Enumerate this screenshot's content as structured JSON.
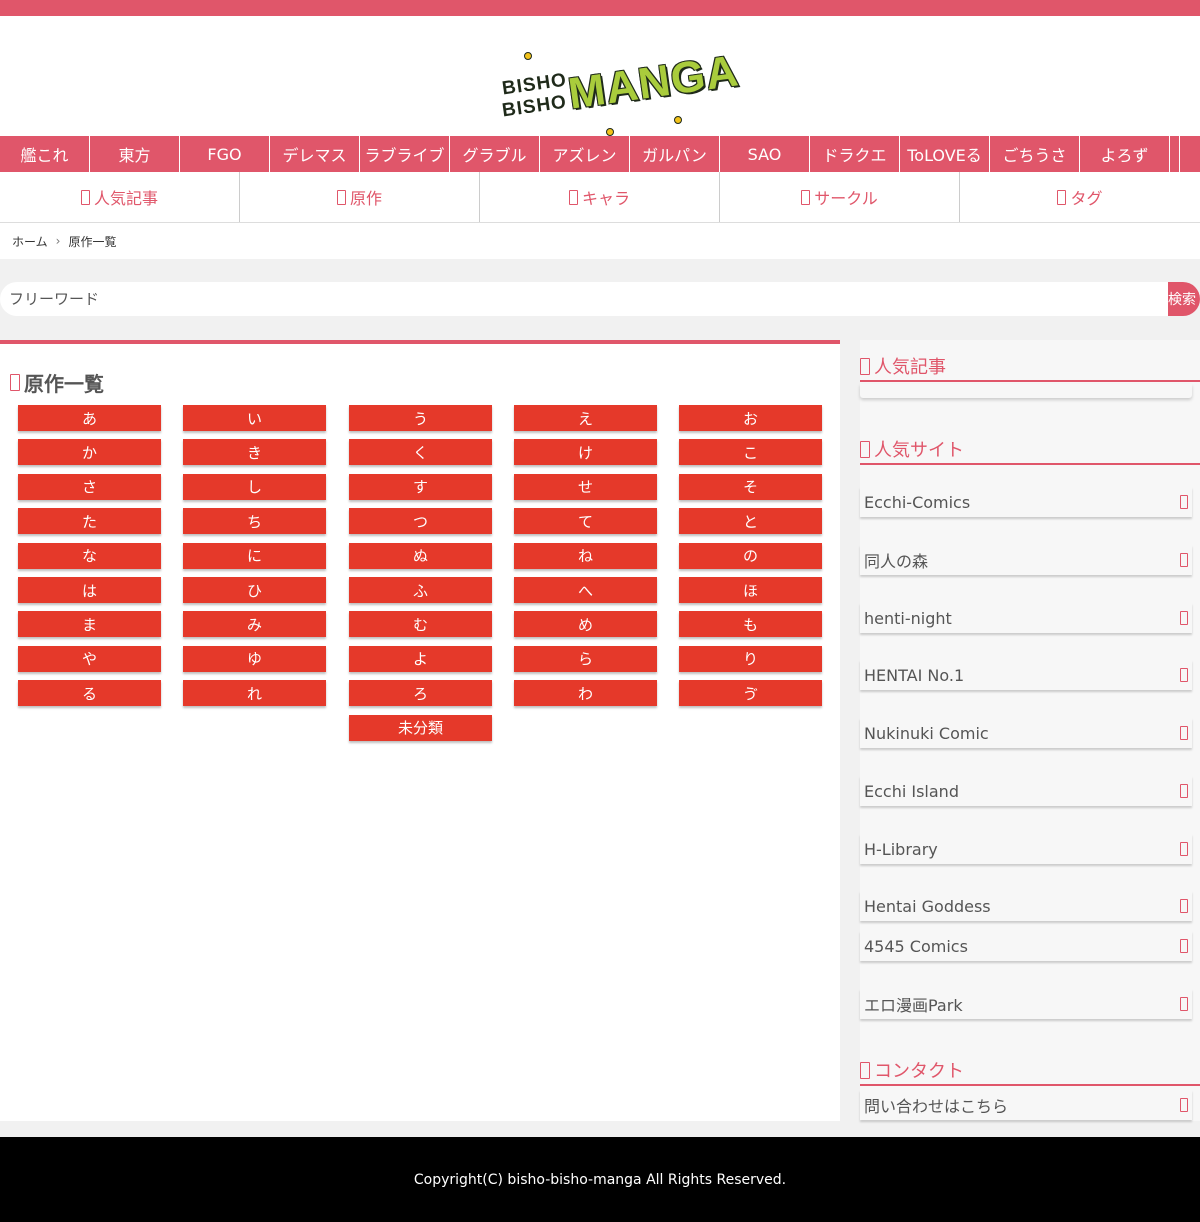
{
  "logo": {
    "line1": "BISHO",
    "line2": "BISHO",
    "word": "MANGA"
  },
  "genres": [
    "艦これ",
    "東方",
    "FGO",
    "デレマス",
    "ラブライブ",
    "グラブル",
    "アズレン",
    "ガルパン",
    "SAO",
    "ドラクエ",
    "ToLOVEる",
    "ごちうさ",
    "よろず"
  ],
  "subnav": [
    "人気記事",
    "原作",
    "キャラ",
    "サークル",
    "タグ"
  ],
  "breadcrumb": {
    "home": "ホーム",
    "sep": "›",
    "current": "原作一覧"
  },
  "search": {
    "placeholder": "フリーワード",
    "button": "検索"
  },
  "main": {
    "title": "原作一覧",
    "kana": [
      "あ",
      "い",
      "う",
      "え",
      "お",
      "か",
      "き",
      "く",
      "け",
      "こ",
      "さ",
      "し",
      "す",
      "せ",
      "そ",
      "た",
      "ち",
      "つ",
      "て",
      "と",
      "な",
      "に",
      "ぬ",
      "ね",
      "の",
      "は",
      "ひ",
      "ふ",
      "へ",
      "ほ",
      "ま",
      "み",
      "む",
      "め",
      "も",
      "や",
      "ゆ",
      "よ",
      "ら",
      "り",
      "る",
      "れ",
      "ろ",
      "わ",
      "ゔ"
    ],
    "uncategorized": "未分類"
  },
  "sidebar": {
    "popular_title": "人気記事",
    "sites_title": "人気サイト",
    "sites": [
      "Ecchi-Comics",
      "同人の森",
      "henti-night",
      "HENTAI No.1",
      "Nukinuki Comic",
      "Ecchi Island",
      "H-Library",
      "Hentai Goddess",
      "4545 Comics",
      "エロ漫画Park"
    ],
    "contact_title": "コンタクト",
    "contact_link": "問い合わせはこちら"
  },
  "footer": {
    "copyright": "Copyright(C) bisho-bisho-manga All Rights Reserved."
  },
  "colors": {
    "accent": "#e0566a",
    "kana_button": "#e5392a",
    "footer_bg": "#000000"
  }
}
